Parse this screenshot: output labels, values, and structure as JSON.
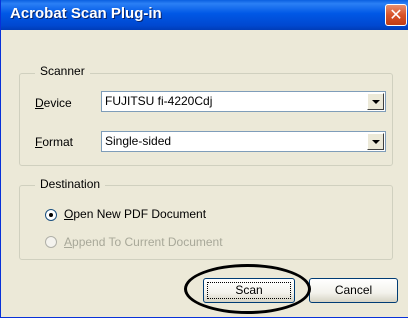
{
  "window": {
    "title": "Acrobat Scan Plug-in",
    "close_symbol": "✕"
  },
  "scanner_group": {
    "legend": "Scanner",
    "device": {
      "label_accel": "D",
      "label_rest": "evice",
      "value": "FUJITSU fi-4220Cdj"
    },
    "format": {
      "label_accel": "F",
      "label_rest": "ormat",
      "value": "Single-sided"
    }
  },
  "destination_group": {
    "legend": "Destination",
    "options": [
      {
        "accel": "O",
        "rest": "pen New PDF Document",
        "checked": true,
        "enabled": true
      },
      {
        "accel": "A",
        "rest": "ppend To Current Document",
        "checked": false,
        "enabled": false
      }
    ]
  },
  "buttons": {
    "scan": "Scan",
    "cancel": "Cancel"
  },
  "icons": {
    "close": "close-icon",
    "dropdown": "chevron-down-icon"
  },
  "colors": {
    "titlebar": "#0058e6",
    "close_button": "#d8532a",
    "dialog_bg": "#ece9d8",
    "disabled_text": "#a8a899"
  }
}
